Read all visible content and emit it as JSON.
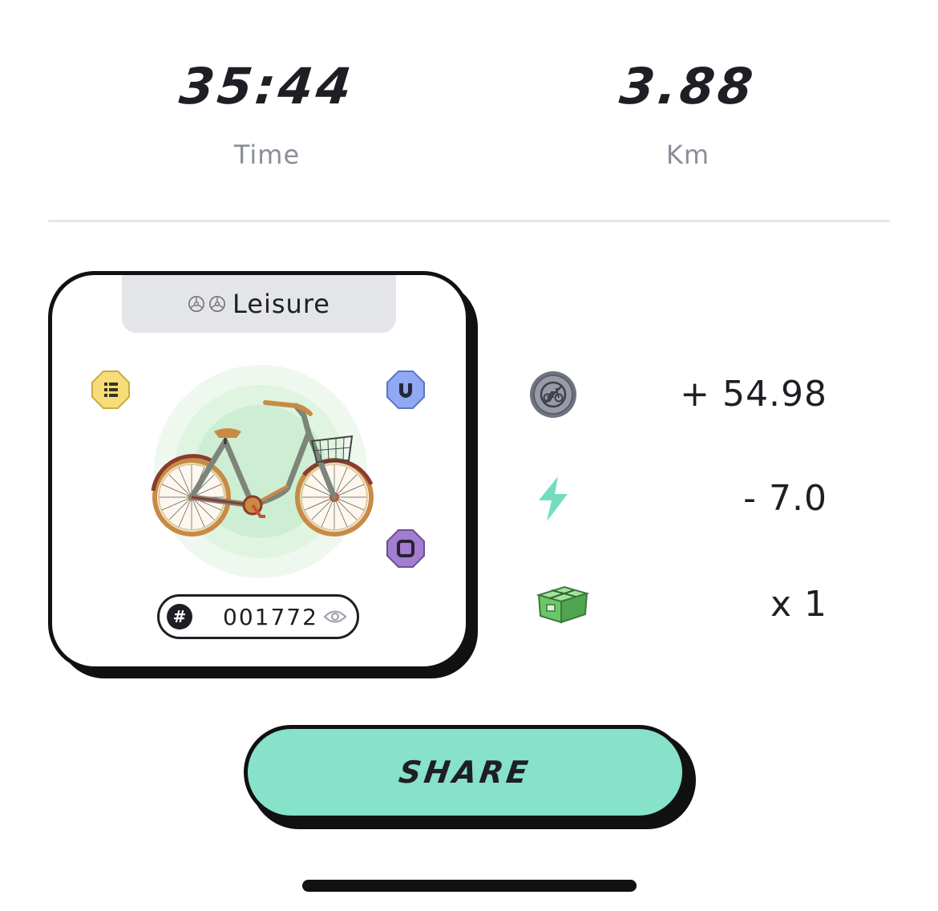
{
  "stats": {
    "time_value": "35:44",
    "time_label": "Time",
    "distance_value": "3.88",
    "distance_label": "Km"
  },
  "card": {
    "category_label": "Leisure",
    "category_icons": [
      "steering-wheel-icon",
      "steering-wheel-icon"
    ],
    "bike_id": "001772",
    "badges": [
      {
        "icon": "list-icon",
        "color": "#f7dd7a"
      },
      {
        "icon": "magnet-icon",
        "color": "#8fa9f2"
      },
      {
        "icon": "square-icon",
        "color": "#a27dd0"
      }
    ]
  },
  "rewards": {
    "coin_value": "+ 54.98",
    "energy_value": "- 7.0",
    "box_value": "x 1"
  },
  "actions": {
    "share_label": "SHARE"
  },
  "colors": {
    "accent": "#86e2c8",
    "text": "#1e1f24",
    "muted": "#8a8e98",
    "energy": "#74dcc0"
  }
}
